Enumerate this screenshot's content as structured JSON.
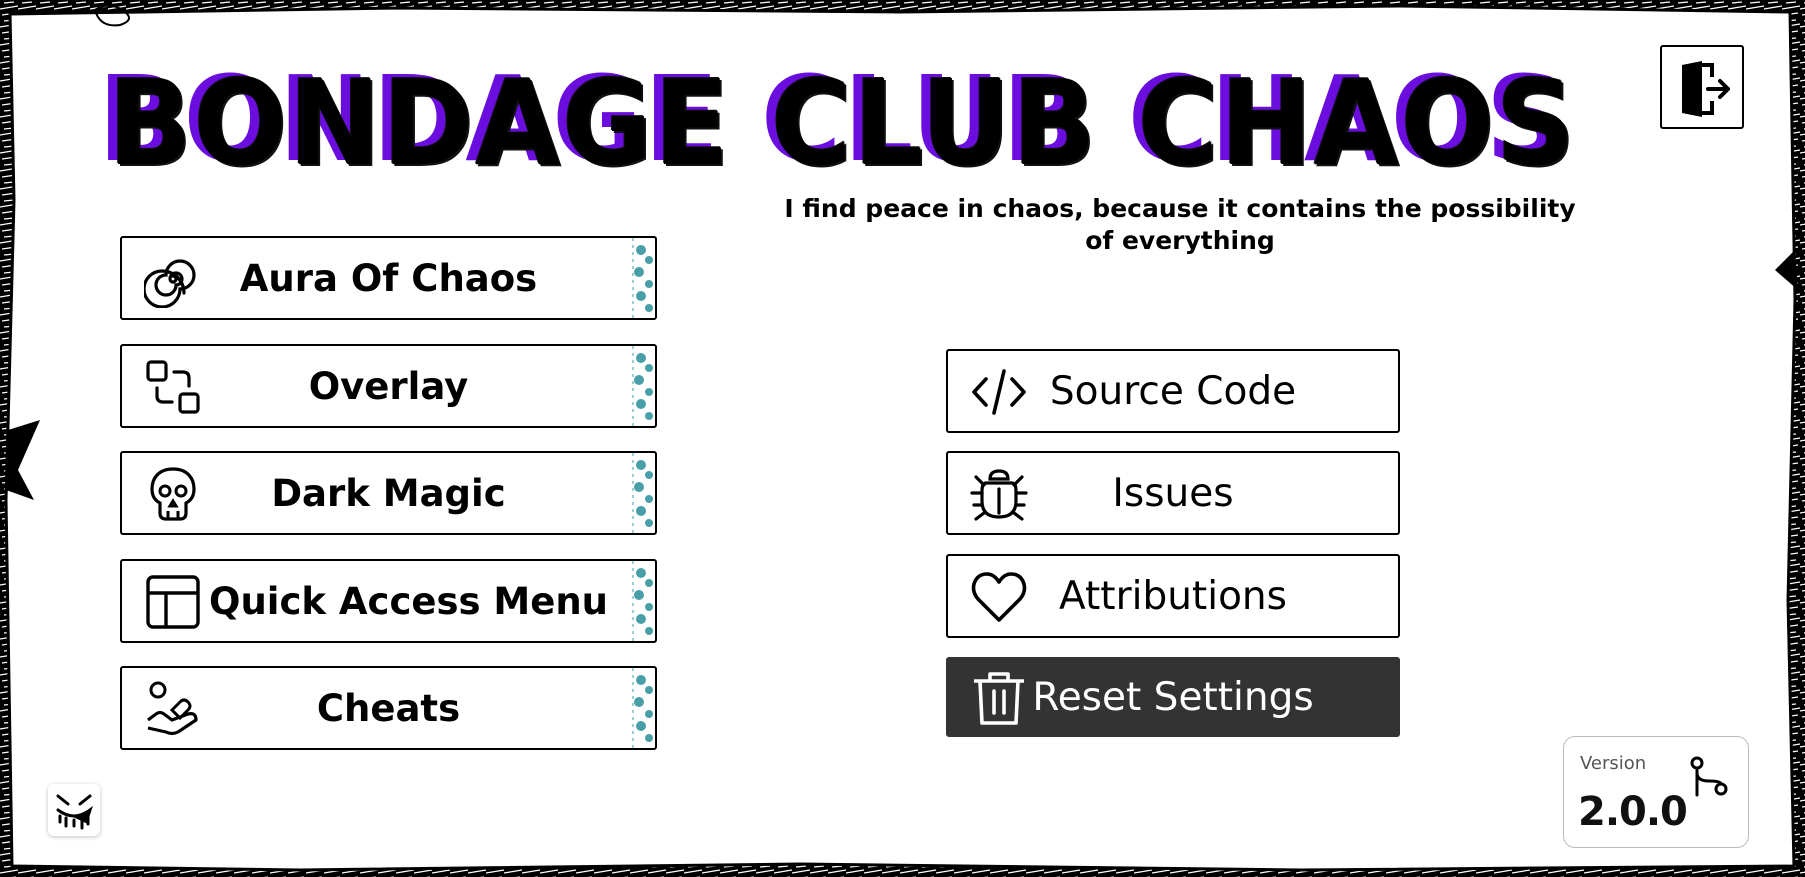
{
  "app": {
    "title": "BONDAGE CLUB CHAOS",
    "subtitle": "I find peace in chaos, because it contains the possibility of everything"
  },
  "left_menu": [
    {
      "label": "Aura Of Chaos",
      "icon": "spiral-icon"
    },
    {
      "label": "Overlay",
      "icon": "overlay-squares-icon"
    },
    {
      "label": "Dark Magic",
      "icon": "skull-icon"
    },
    {
      "label": "Quick Access Menu",
      "icon": "layout-icon"
    },
    {
      "label": "Cheats",
      "icon": "hand-heart-icon"
    }
  ],
  "right_menu": [
    {
      "label": "Source Code",
      "icon": "code-icon"
    },
    {
      "label": "Issues",
      "icon": "bug-icon"
    },
    {
      "label": "Attributions",
      "icon": "heart-icon"
    },
    {
      "label": "Reset Settings",
      "icon": "trash-icon"
    }
  ],
  "exit": {
    "icon": "exit-door-icon"
  },
  "version": {
    "label": "Version",
    "value": "2.0.0",
    "icon": "git-branch-icon"
  },
  "mascot": {
    "icon": "dripping-face-icon"
  },
  "colors": {
    "title_accent": "#6a0dde",
    "reset_button_bg": "#333333",
    "deco_teal": "#2a8f9a"
  }
}
